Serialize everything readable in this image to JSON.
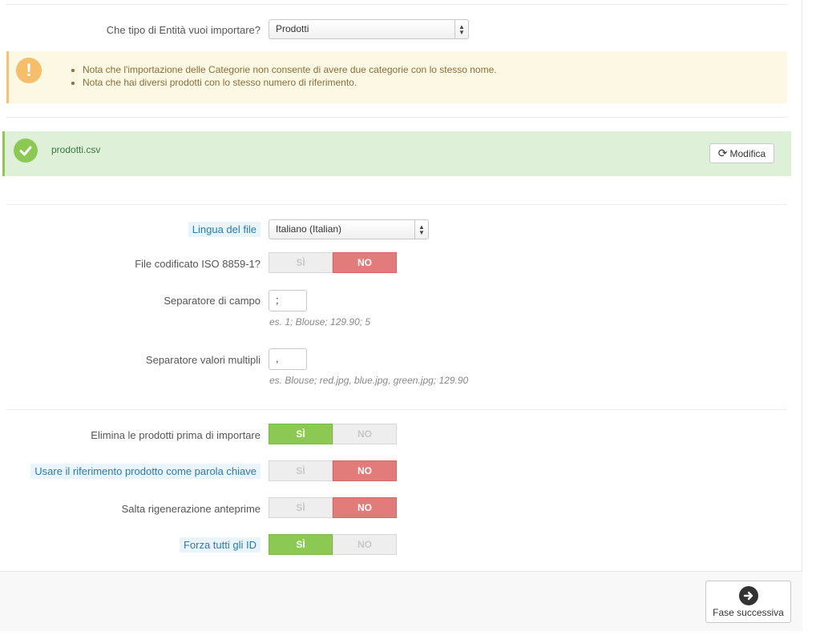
{
  "entity": {
    "label": "Che tipo di Entità vuoi importare?",
    "value": "Prodotti"
  },
  "warning": {
    "icon": "exclamation-icon",
    "items": [
      "Nota che l'importazione delle Categorie non consente di avere due categorie con lo stesso nome.",
      "Nota che hai diversi prodotti con lo stesso numero di riferimento."
    ]
  },
  "file": {
    "name": "prodotti.csv",
    "modify_label": "Modifica"
  },
  "settings": {
    "language_label": "Lingua del file",
    "language_value": "Italiano (Italian)",
    "iso_label": "File codificato ISO 8859-1?",
    "field_sep_label": "Separatore di campo",
    "field_sep_value": ";",
    "field_sep_help": "es. 1; Blouse; 129.90; 5",
    "multi_sep_label": "Separatore valori multipli",
    "multi_sep_value": ",",
    "multi_sep_help": "es. Blouse; red.jpg, blue.jpg, green.jpg; 129.90"
  },
  "toggles": {
    "yes": "SÌ",
    "no": "NO",
    "iso": "no",
    "delete_label": "Elimina le prodotti prima di importare",
    "delete": "yes",
    "ref_key_label": "Usare il riferimento prodotto come parola chiave",
    "ref_key": "no",
    "skip_thumb_label": "Salta rigenerazione anteprime",
    "skip_thumb": "no",
    "force_ids_label": "Forza tutti gli ID",
    "force_ids": "yes"
  },
  "footer": {
    "next_label": "Fase successiva"
  },
  "colors": {
    "yes_active": "#8bc954",
    "no_active": "#e27c7a",
    "warning_bg": "#fcf8e3",
    "success_bg": "#dff0d8"
  }
}
